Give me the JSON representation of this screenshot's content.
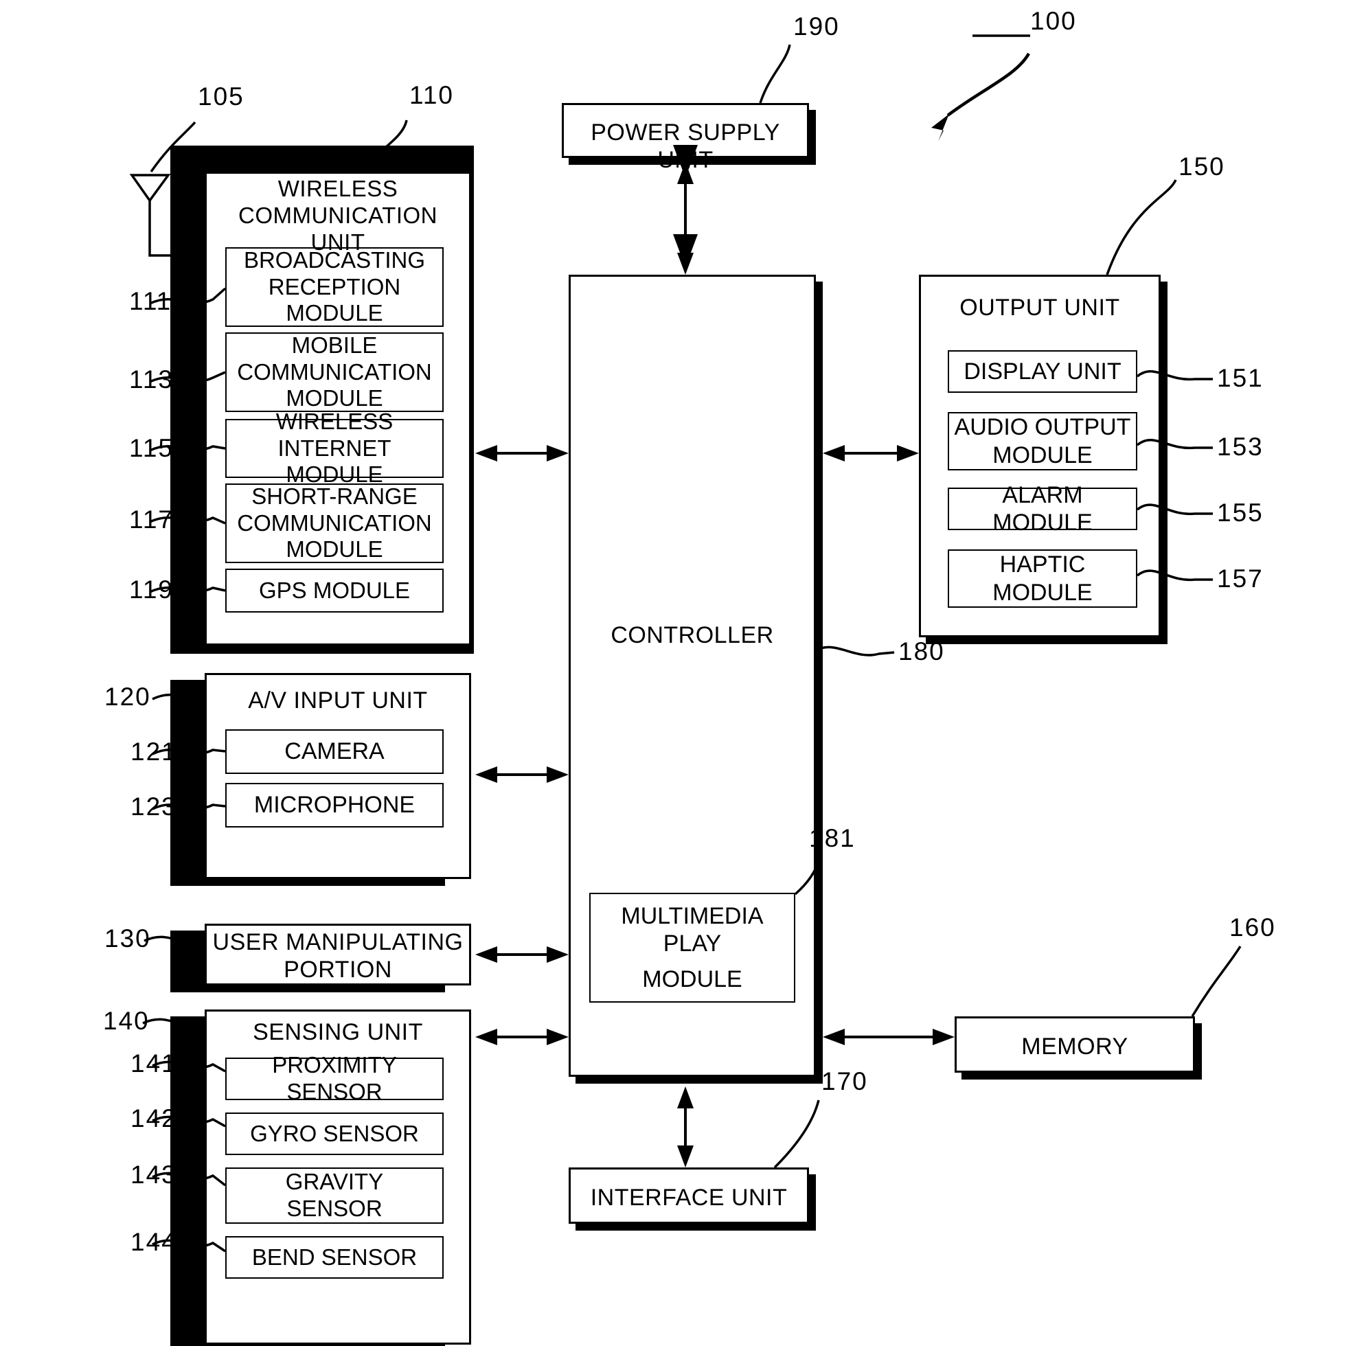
{
  "figure": {
    "system_ref": "100",
    "antenna_ref": "105"
  },
  "blocks": {
    "wireless_communication_unit": {
      "title": "WIRELESS COMMUNICATION UNIT",
      "ref": "110",
      "modules": [
        {
          "label": "BROADCASTING RECEPTION MODULE",
          "ref": "111"
        },
        {
          "label": "MOBILE COMMUNICATION MODULE",
          "ref": "113"
        },
        {
          "label": "WIRELESS INTERNET MODULE",
          "ref": "115"
        },
        {
          "label": "SHORT-RANGE COMMUNICATION MODULE",
          "ref": "117"
        },
        {
          "label": "GPS MODULE",
          "ref": "119"
        }
      ]
    },
    "av_input_unit": {
      "title": "A/V INPUT UNIT",
      "ref": "120",
      "modules": [
        {
          "label": "CAMERA",
          "ref": "121"
        },
        {
          "label": "MICROPHONE",
          "ref": "123"
        }
      ]
    },
    "user_manipulating_portion": {
      "title": "USER MANIPULATING PORTION",
      "ref": "130"
    },
    "sensing_unit": {
      "title": "SENSING UNIT",
      "ref": "140",
      "modules": [
        {
          "label": "PROXIMITY SENSOR",
          "ref": "141"
        },
        {
          "label": "GYRO SENSOR",
          "ref": "142"
        },
        {
          "label": "GRAVITY SENSOR",
          "ref": "143"
        },
        {
          "label": "BEND SENSOR",
          "ref": "144"
        }
      ]
    },
    "controller": {
      "title": "CONTROLLER",
      "ref": "180",
      "modules": [
        {
          "label": "MULTIMEDIA PLAY MODULE",
          "ref": "181"
        }
      ]
    },
    "power_supply_unit": {
      "title": "POWER SUPPLY UNIT",
      "ref": "190"
    },
    "output_unit": {
      "title": "OUTPUT UNIT",
      "ref": "150",
      "modules": [
        {
          "label": "DISPLAY UNIT",
          "ref": "151"
        },
        {
          "label": "AUDIO OUTPUT MODULE",
          "ref": "153"
        },
        {
          "label": "ALARM  MODULE",
          "ref": "155"
        },
        {
          "label": "HAPTIC MODULE",
          "ref": "157"
        }
      ]
    },
    "memory": {
      "title": "MEMORY",
      "ref": "160"
    },
    "interface_unit": {
      "title": "INTERFACE UNIT",
      "ref": "170"
    }
  },
  "module_lines": {
    "broadcasting_reception": [
      "BROADCASTING",
      "RECEPTION",
      "MODULE"
    ],
    "mobile_communication": [
      "MOBILE",
      "COMMUNICATION",
      "MODULE"
    ],
    "wireless_internet": [
      "WIRELESS",
      "INTERNET MODULE"
    ],
    "short_range_communication": [
      "SHORT-RANGE",
      "COMMUNICATION",
      "MODULE"
    ],
    "gps": [
      "GPS MODULE"
    ],
    "wireless_unit_title": [
      "WIRELESS",
      "COMMUNICATION",
      "UNIT"
    ],
    "audio_output": [
      "AUDIO OUTPUT",
      "MODULE"
    ],
    "haptic": [
      "HAPTIC",
      "MODULE"
    ],
    "gravity_sensor": [
      "GRAVITY",
      "SENSOR"
    ],
    "user_manipulating": [
      "USER MANIPULATING",
      "PORTION"
    ],
    "multimedia_play": [
      "MULTIMEDIA PLAY",
      "MODULE"
    ]
  },
  "colors": {
    "ink": "#000000",
    "paper": "#ffffff"
  }
}
